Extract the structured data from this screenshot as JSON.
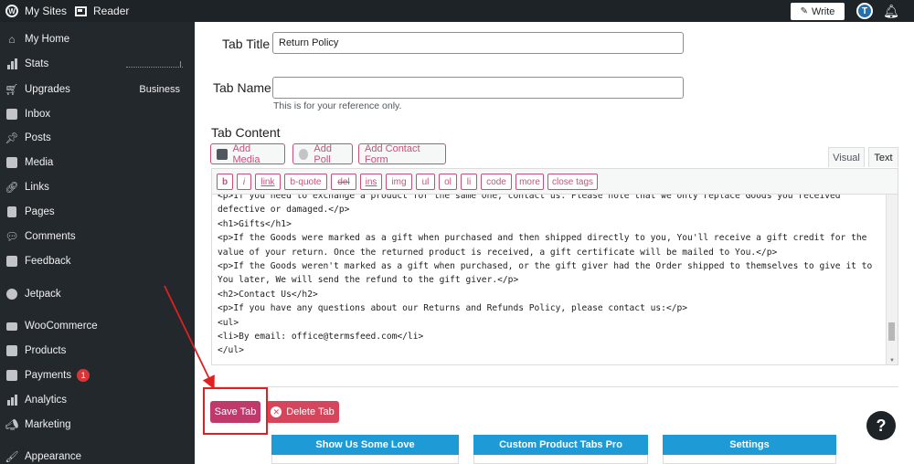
{
  "topbar": {
    "my_sites": "My Sites",
    "reader": "Reader",
    "write": "Write",
    "avatar_letter": "T"
  },
  "sidebar": {
    "items": [
      {
        "label": "My Home",
        "icon": "home-icon"
      },
      {
        "label": "Stats",
        "icon": "stats-icon"
      },
      {
        "label": "Upgrades",
        "icon": "cart-icon",
        "extra": "Business"
      },
      {
        "label": "Inbox",
        "icon": "inbox-icon"
      },
      {
        "label": "Posts",
        "icon": "pin-icon"
      },
      {
        "label": "Media",
        "icon": "media-icon"
      },
      {
        "label": "Links",
        "icon": "link-icon"
      },
      {
        "label": "Pages",
        "icon": "pages-icon"
      },
      {
        "label": "Comments",
        "icon": "comments-icon"
      },
      {
        "label": "Feedback",
        "icon": "feedback-icon"
      },
      {
        "label": "Jetpack",
        "icon": "jetpack-icon"
      },
      {
        "label": "WooCommerce",
        "icon": "woo-icon"
      },
      {
        "label": "Products",
        "icon": "products-icon"
      },
      {
        "label": "Payments",
        "icon": "payments-icon",
        "badge": "1"
      },
      {
        "label": "Analytics",
        "icon": "analytics-icon"
      },
      {
        "label": "Marketing",
        "icon": "megaphone-icon"
      },
      {
        "label": "Appearance",
        "icon": "brush-icon"
      }
    ]
  },
  "form": {
    "tab_title_label": "Tab Title",
    "tab_title_value": "Return Policy",
    "tab_name_label": "Tab Name",
    "tab_name_value": "",
    "tab_name_hint": "This is for your reference only.",
    "tab_content_label": "Tab Content"
  },
  "media_buttons": {
    "add_media": "Add Media",
    "add_poll": "Add Poll",
    "add_contact_form": "Add Contact Form"
  },
  "editor_tabs": {
    "visual": "Visual",
    "text": "Text"
  },
  "quicktags": [
    "b",
    "i",
    "link",
    "b-quote",
    "del",
    "ins",
    "img",
    "ul",
    "ol",
    "li",
    "code",
    "more",
    "close tags"
  ],
  "editor_content": "<p>If you need to exchange a product for the same one, contact us. Please note that we only replace Goods you received defective or damaged.</p>\n<h1>Gifts</h1>\n<p>If the Goods were marked as a gift when purchased and then shipped directly to you, You'll receive a gift credit for the value of your return. Once the returned product is received, a gift certificate will be mailed to You.</p>\n<p>If the Goods weren't marked as a gift when purchased, or the gift giver had the Order shipped to themselves to give it to You later, We will send the refund to the gift giver.</p>\n<h2>Contact Us</h2>\n<p>If you have any questions about our Returns and Refunds Policy, please contact us:</p>\n<ul>\n<li>By email: office@termsfeed.com</li>\n</ul>",
  "actions": {
    "save": "Save Tab",
    "delete": "Delete Tab"
  },
  "cards": [
    "Show Us Some Love",
    "Custom Product Tabs Pro",
    "Settings"
  ],
  "help": "?",
  "colors": {
    "accent": "#c0396b",
    "delete": "#d5455b",
    "card_header": "#1e9bd7",
    "highlight": "#e02020"
  }
}
